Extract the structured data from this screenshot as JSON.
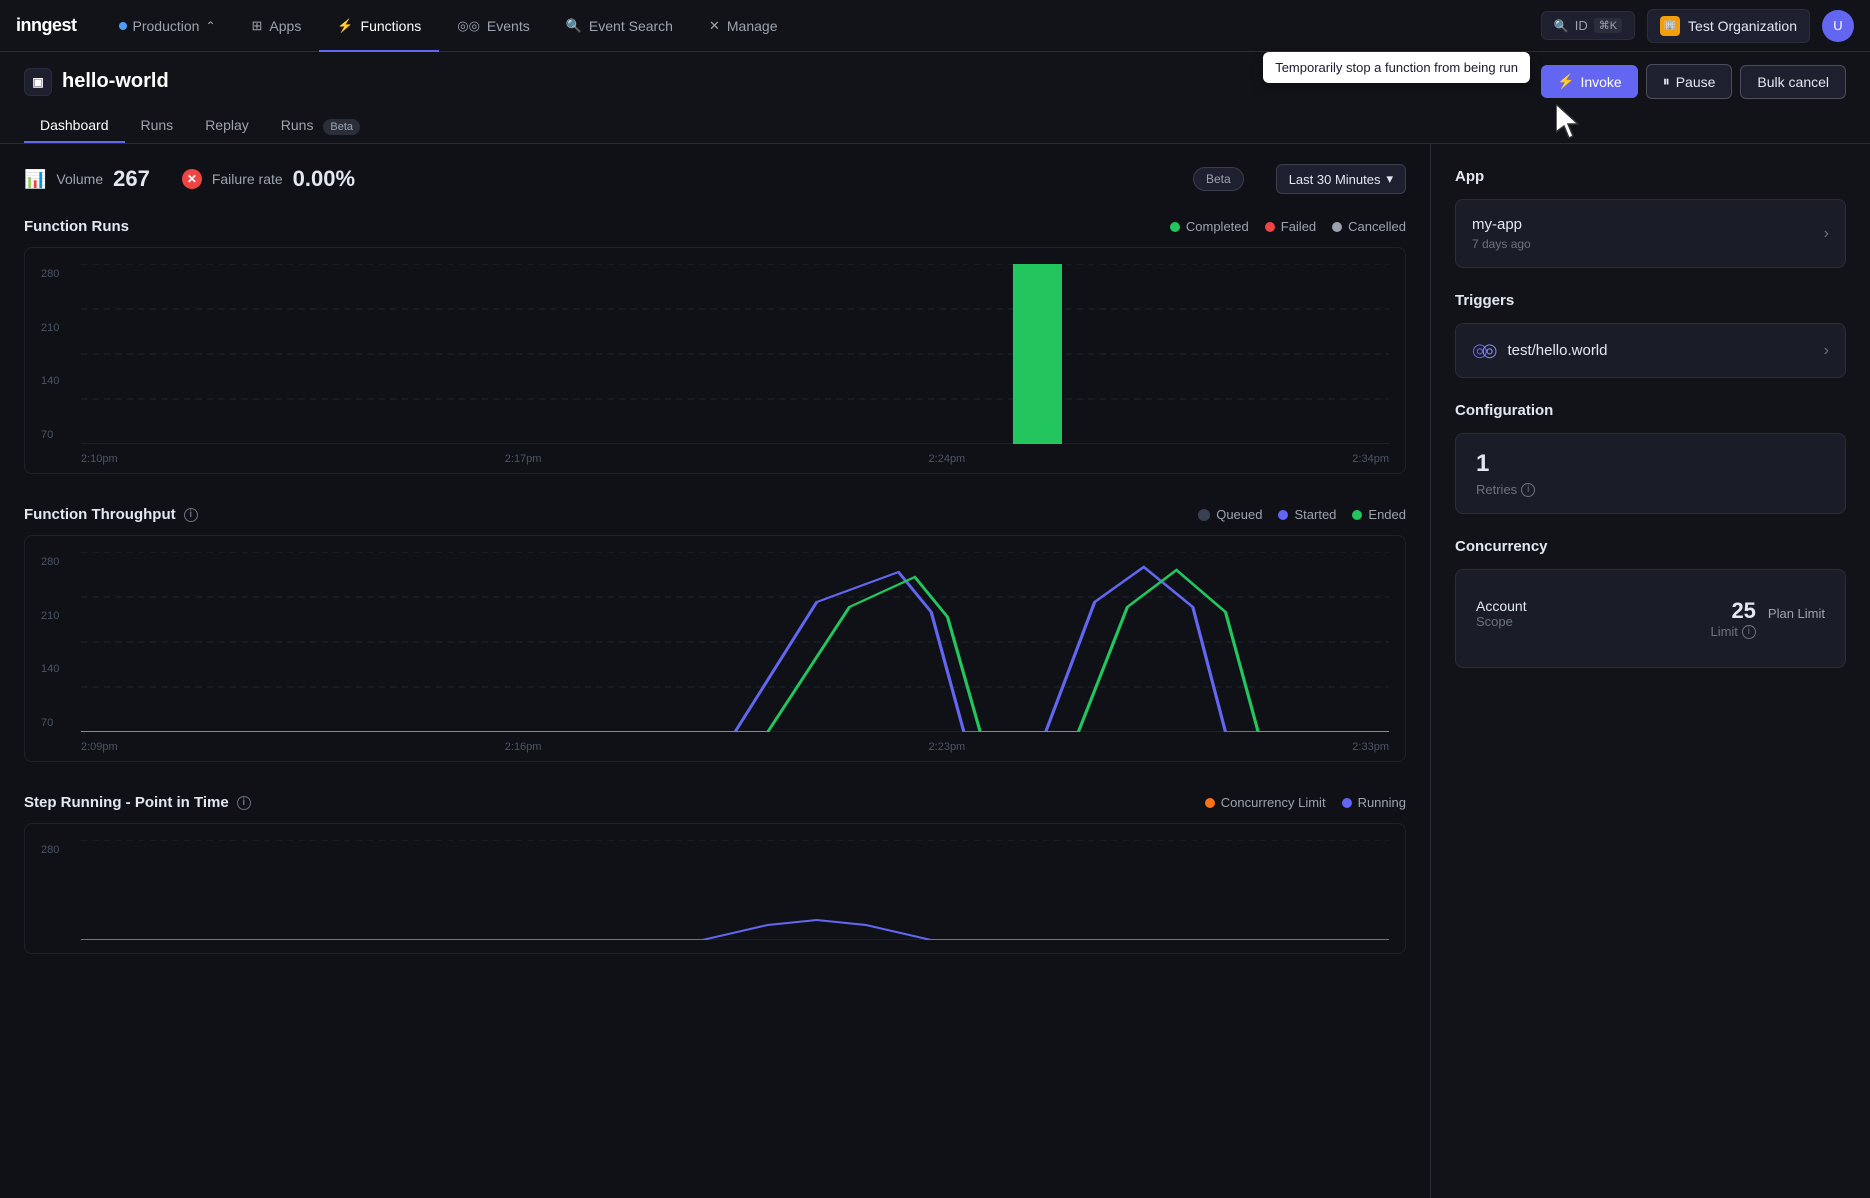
{
  "app": {
    "logo": "inngest"
  },
  "nav": {
    "items": [
      {
        "id": "production",
        "label": "Production",
        "active": false,
        "hasDot": true,
        "hasChevron": true
      },
      {
        "id": "apps",
        "label": "Apps",
        "active": false,
        "hasDot": false,
        "icon": "grid"
      },
      {
        "id": "functions",
        "label": "Functions",
        "active": true,
        "hasDot": false,
        "icon": "functions"
      },
      {
        "id": "events",
        "label": "Events",
        "active": false,
        "hasDot": false,
        "icon": "events"
      },
      {
        "id": "event-search",
        "label": "Event Search",
        "active": false,
        "hasDot": false,
        "icon": "search"
      },
      {
        "id": "manage",
        "label": "Manage",
        "active": false,
        "hasDot": false,
        "icon": "manage"
      }
    ],
    "id_button": "ID",
    "id_shortcut": "⌘K",
    "org": "Test Organization",
    "tooltip": "Temporarily stop a function from being run"
  },
  "function": {
    "name": "hello-world",
    "tabs": [
      {
        "id": "dashboard",
        "label": "Dashboard",
        "active": true
      },
      {
        "id": "runs",
        "label": "Runs",
        "active": false
      },
      {
        "id": "replay",
        "label": "Replay",
        "active": false
      },
      {
        "id": "runs-beta",
        "label": "Runs",
        "active": false,
        "badge": "Beta"
      }
    ],
    "buttons": {
      "invoke": "Invoke",
      "pause": "Pause",
      "bulk_cancel": "Bulk cancel"
    }
  },
  "metrics": {
    "volume_label": "Volume",
    "volume_value": "267",
    "failure_rate_label": "Failure rate",
    "failure_rate_value": "0.00%",
    "beta_label": "Beta",
    "time_selector": "Last 30 Minutes"
  },
  "function_runs_chart": {
    "title": "Function Runs",
    "legend": [
      {
        "id": "completed",
        "label": "Completed",
        "color": "#22c55e"
      },
      {
        "id": "failed",
        "label": "Failed",
        "color": "#ef4444"
      },
      {
        "id": "cancelled",
        "label": "Cancelled",
        "color": "#9ca3af"
      }
    ],
    "y_labels": [
      "280",
      "210",
      "140",
      "70"
    ],
    "x_labels": [
      "2:10pm",
      "2:17pm",
      "2:24pm",
      "2:34pm"
    ],
    "bar_data": {
      "spike_position": 0.75,
      "spike_height": 280,
      "color": "#22c55e"
    }
  },
  "function_throughput_chart": {
    "title": "Function Throughput",
    "legend": [
      {
        "id": "queued",
        "label": "Queued",
        "color": "#374151"
      },
      {
        "id": "started",
        "label": "Started",
        "color": "#6366f1"
      },
      {
        "id": "ended",
        "label": "Ended",
        "color": "#22c55e"
      }
    ],
    "y_labels": [
      "280",
      "210",
      "140",
      "70"
    ],
    "x_labels": [
      "2:09pm",
      "2:16pm",
      "2:23pm",
      "2:33pm"
    ]
  },
  "step_running_chart": {
    "title": "Step Running - Point in Time",
    "legend": [
      {
        "id": "concurrency-limit",
        "label": "Concurrency Limit",
        "color": "#f97316"
      },
      {
        "id": "running",
        "label": "Running",
        "color": "#6366f1"
      }
    ],
    "y_labels": [
      "280"
    ],
    "x_labels": []
  },
  "sidebar": {
    "app_section_title": "App",
    "app_card": {
      "name": "my-app",
      "time": "7 days ago"
    },
    "triggers_section_title": "Triggers",
    "trigger_card": {
      "name": "test/hello.world"
    },
    "configuration_section_title": "Configuration",
    "retries_value": "1",
    "retries_label": "Retries",
    "concurrency_section_title": "Concurrency",
    "concurrency": {
      "account_label": "Account",
      "scope_label": "Scope",
      "limit_value": "25",
      "limit_label": "Limit",
      "plan_limit_label": "Plan Limit"
    }
  }
}
